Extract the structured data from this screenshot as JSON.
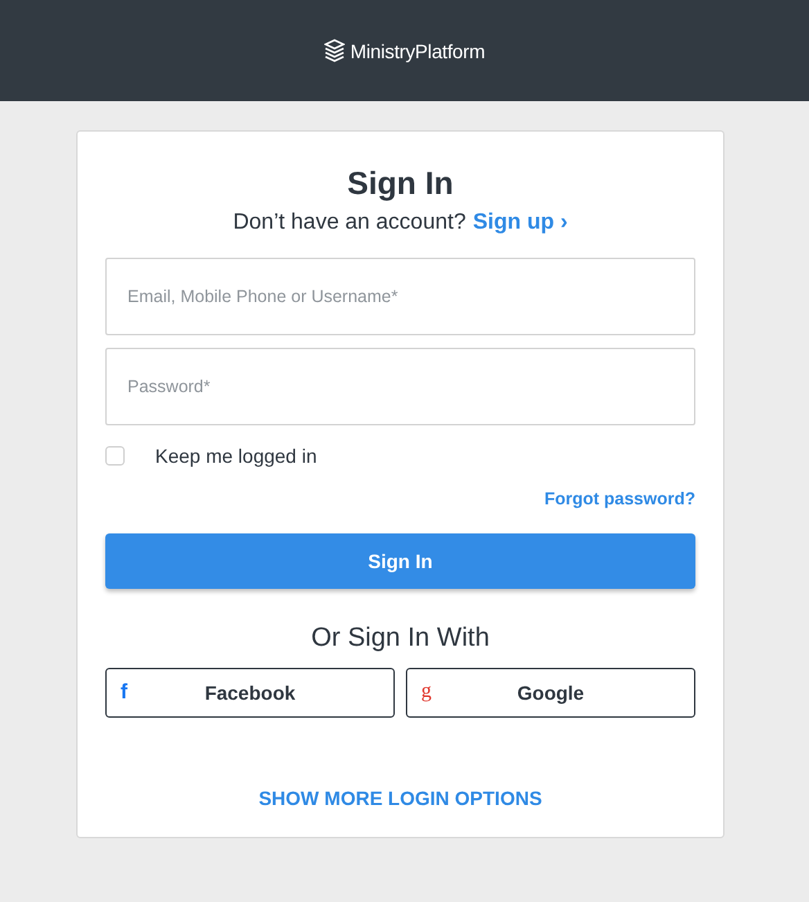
{
  "header": {
    "brand": "MinistryPlatform"
  },
  "form": {
    "title": "Sign In",
    "prompt": "Don’t have an account?",
    "signup_link": "Sign up ›",
    "fields": [
      {
        "placeholder": "Email, Mobile Phone or Username*"
      },
      {
        "placeholder": "Password*"
      }
    ],
    "remember": {
      "label": "Keep me logged in",
      "checked": false
    },
    "forgot_link": "Forgot password?",
    "submit": "Sign In",
    "alt_heading": "Or Sign In With",
    "providers": [
      {
        "kind": "facebook",
        "glyph": "f",
        "label": "Facebook"
      },
      {
        "kind": "google",
        "glyph": "g",
        "label": "Google"
      }
    ],
    "more_link": "SHOW MORE LOGIN OPTIONS"
  }
}
